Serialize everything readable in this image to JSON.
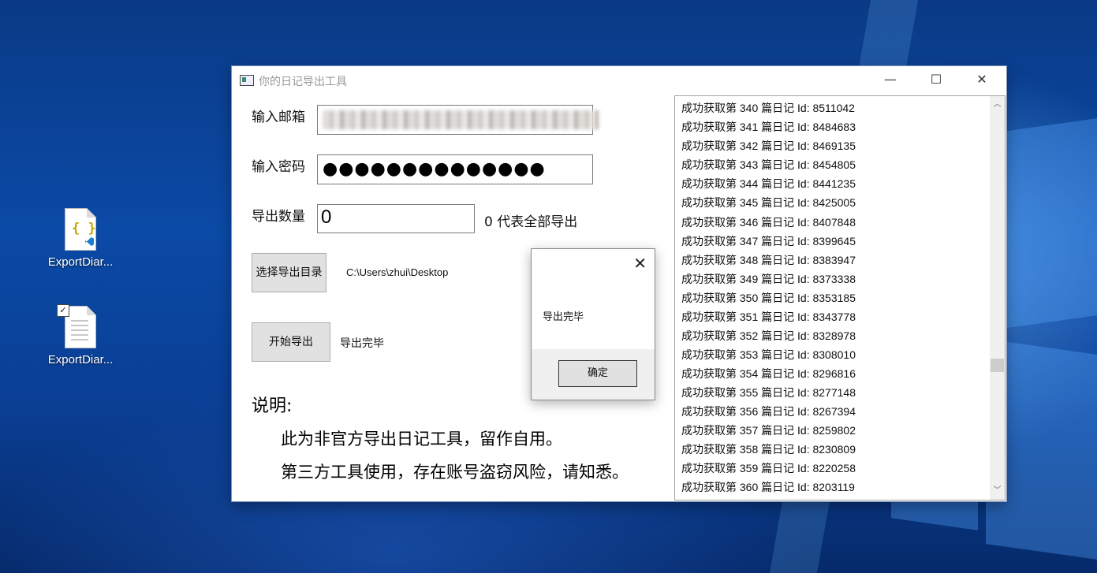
{
  "desktop": {
    "icons": [
      {
        "label": "ExportDiar...",
        "type": "json"
      },
      {
        "label": "ExportDiar...",
        "type": "text"
      }
    ]
  },
  "window": {
    "title": "你的日记导出工具",
    "minimize_glyph": "—",
    "maximize_glyph": "☐",
    "close_glyph": "✕"
  },
  "form": {
    "email_label": "输入邮箱",
    "password_label": "输入密码",
    "password_mask": "●●●●●●●●●●●●●●",
    "count_label": "导出数量",
    "count_value": "0",
    "count_hint": "0 代表全部导出",
    "choose_dir_button": "选择导出目录",
    "dir_path": "C:\\Users\\zhui\\Desktop",
    "start_button": "开始导出",
    "status": "导出完毕"
  },
  "description": {
    "title": "说明:",
    "lines": [
      "此为非官方导出日记工具，留作自用。",
      "第三方工具使用，存在账号盗窃风险，请知悉。"
    ]
  },
  "log": {
    "rows": [
      "成功获取第 340 篇日记 Id: 8511042",
      "成功获取第 341 篇日记 Id: 8484683",
      "成功获取第 342 篇日记 Id: 8469135",
      "成功获取第 343 篇日记 Id: 8454805",
      "成功获取第 344 篇日记 Id: 8441235",
      "成功获取第 345 篇日记 Id: 8425005",
      "成功获取第 346 篇日记 Id: 8407848",
      "成功获取第 347 篇日记 Id: 8399645",
      "成功获取第 348 篇日记 Id: 8383947",
      "成功获取第 349 篇日记 Id: 8373338",
      "成功获取第 350 篇日记 Id: 8353185",
      "成功获取第 351 篇日记 Id: 8343778",
      "成功获取第 352 篇日记 Id: 8328978",
      "成功获取第 353 篇日记 Id: 8308010",
      "成功获取第 354 篇日记 Id: 8296816",
      "成功获取第 355 篇日记 Id: 8277148",
      "成功获取第 356 篇日记 Id: 8267394",
      "成功获取第 357 篇日记 Id: 8259802",
      "成功获取第 358 篇日记 Id: 8230809",
      "成功获取第 359 篇日记 Id: 8220258",
      "成功获取第 360 篇日记 Id: 8203119"
    ],
    "scroll_up_glyph": "︿",
    "scroll_down_glyph": "﹀"
  },
  "dialog": {
    "message": "导出完毕",
    "ok_button": "确定",
    "close_glyph": "✕"
  }
}
